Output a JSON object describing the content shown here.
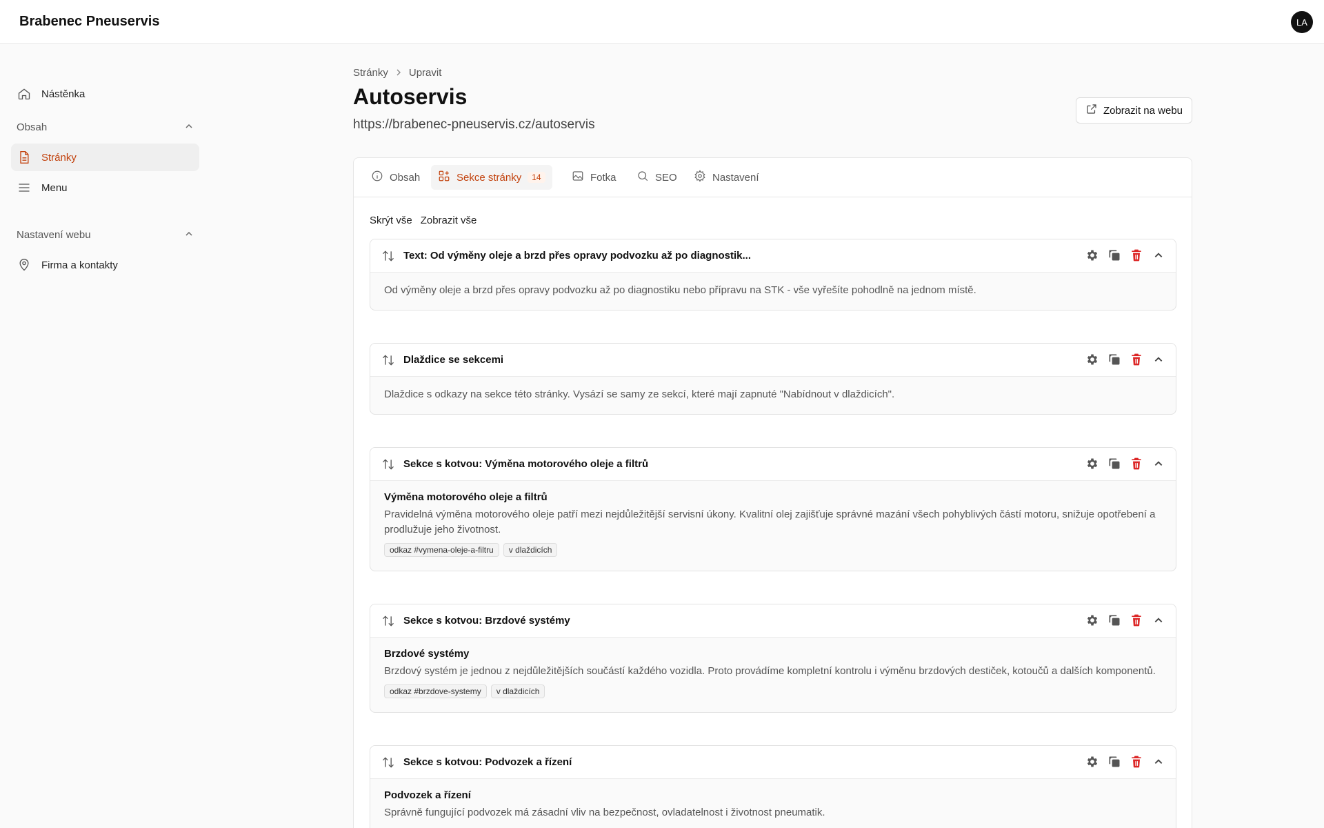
{
  "app": {
    "brand": "Brabenec Pneuservis",
    "avatar_initials": "LA"
  },
  "sidebar": {
    "dashboard": "Nástěnka",
    "group_content": "Obsah",
    "pages": "Stránky",
    "menu": "Menu",
    "group_web_settings": "Nastavení webu",
    "company": "Firma a kontakty"
  },
  "page": {
    "breadcrumb": [
      "Stránky",
      "Upravit"
    ],
    "title": "Autoservis",
    "url": "https://brabenec-pneuservis.cz/autoservis",
    "view_button": "Zobrazit na webu"
  },
  "tabs": [
    {
      "label": "Obsah"
    },
    {
      "label": "Sekce stránky",
      "badge": "14"
    },
    {
      "label": "Fotka"
    },
    {
      "label": "SEO"
    },
    {
      "label": "Nastavení"
    }
  ],
  "toggles": {
    "hide_all": "Skrýt vše",
    "show_all": "Zobrazit vše"
  },
  "sections": [
    {
      "title": "Text: Od výměny oleje a brzd přes opravy podvozku až po diagnostik...",
      "body_title": "",
      "body": "Od výměny oleje a brzd přes opravy podvozku až po diagnostiku nebo přípravu na STK - vše vyřešíte pohodlně na jednom místě.",
      "tags": []
    },
    {
      "title": "Dlaždice se sekcemi",
      "body_title": "",
      "body": "Dlaždice s odkazy na sekce této stránky. Vysází se samy ze sekcí, které mají zapnuté \"Nabídnout v dlaždicích\".",
      "tags": []
    },
    {
      "title": "Sekce s kotvou: Výměna motorového oleje a filtrů",
      "body_title": "Výměna motorového oleje a filtrů",
      "body": "Pravidelná výměna motorového oleje patří mezi nejdůležitější servisní úkony. Kvalitní olej zajišťuje správné mazání všech pohyblivých částí motoru, snižuje opotřebení a prodlužuje jeho životnost.",
      "tags": [
        "odkaz #vymena-oleje-a-filtru",
        "v dlaždicích"
      ]
    },
    {
      "title": "Sekce s kotvou: Brzdové systémy",
      "body_title": "Brzdové systémy",
      "body": "Brzdový systém je jednou z nejdůležitějších součástí každého vozidla. Proto provádíme kompletní kontrolu i výměnu brzdových destiček, kotoučů a dalších komponentů.",
      "tags": [
        "odkaz #brzdove-systemy",
        "v dlaždicích"
      ]
    },
    {
      "title": "Sekce s kotvou: Podvozek a řízení",
      "body_title": "Podvozek a řízení",
      "body": "Správně fungující podvozek má zásadní vliv na bezpečnost, ovladatelnost i životnost pneumatik.",
      "tags": []
    }
  ],
  "colors": {
    "accent": "#c2410c",
    "danger": "#dc2626"
  },
  "icons": {
    "section_actions": [
      "gear-icon",
      "duplicate-icon",
      "trash-icon",
      "chevron-up-icon"
    ],
    "drag": "sort-arrows-icon"
  }
}
